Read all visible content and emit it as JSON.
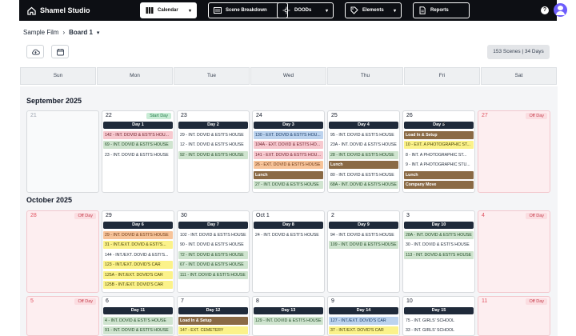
{
  "app": {
    "title": "Shamel Studio"
  },
  "nav": {
    "calendar": "Calendar",
    "scene_breakdown": "Scene Breakdown",
    "doods": "DOODs",
    "elements": "Elements",
    "reports": "Reports"
  },
  "breadcrumb": {
    "project": "Sample Film",
    "board": "Board 1"
  },
  "scene_count": "153 Scenes | 34 Days",
  "weekdays": [
    "Sun",
    "Mon",
    "Tue",
    "Wed",
    "Thu",
    "Fri",
    "Sat"
  ],
  "months": {
    "sep": "September 2025",
    "oct": "October 2025"
  },
  "weeks": [
    {
      "days": [
        {
          "num": "21",
          "type": "empty",
          "badge": "",
          "header": "",
          "items": []
        },
        {
          "num": "22",
          "type": "shoot",
          "badge": "Start Day",
          "header": "Day 1",
          "items": [
            {
              "t": "142 - INT. DOVID & ESTI'S HOU...",
              "c": "pink"
            },
            {
              "t": "69 - INT. DOVID & ESTI'S HOUSE",
              "c": "green"
            },
            {
              "t": "23 - INT. DOVID & ESTI'S HOUSE",
              "c": "white"
            }
          ]
        },
        {
          "num": "23",
          "type": "shoot",
          "badge": "",
          "header": "Day 2",
          "items": [
            {
              "t": "29 - INT. DOVID & ESTI'S HOUSE",
              "c": "white"
            },
            {
              "t": "12 - INT. DOVID & ESTI'S HOUSE",
              "c": "white"
            },
            {
              "t": "92 - INT. DOVID & ESTI'S HOUSE",
              "c": "green"
            }
          ]
        },
        {
          "num": "24",
          "type": "shoot",
          "badge": "",
          "header": "Day 3",
          "items": [
            {
              "t": "130 - EXT. DOVID & ESTI'S HOU...",
              "c": "blue"
            },
            {
              "t": "104A - EXT. DOVID & ESTI'S HO...",
              "c": "pink"
            },
            {
              "t": "141 - EXT. DOVID & ESTI'S HOUSE",
              "c": "pink"
            },
            {
              "t": "26 - EXT. DOVID & ESTI'S HOUSE",
              "c": "orange"
            },
            {
              "t": "Lunch",
              "c": "brown"
            },
            {
              "t": "27 - INT. DOVID & ESTI'S HOUSE",
              "c": "green"
            }
          ]
        },
        {
          "num": "25",
          "type": "shoot",
          "badge": "",
          "header": "Day 4",
          "items": [
            {
              "t": "95 - INT. DOVID & ESTI'S HOUSE",
              "c": "white"
            },
            {
              "t": "23A - INT. DOVID & ESTI'S HOUSE",
              "c": "white"
            },
            {
              "t": "28 - INT. DOVID & ESTI'S HOUSE",
              "c": "green"
            },
            {
              "t": "Lunch",
              "c": "brown"
            },
            {
              "t": "80 - INT. DOVID & ESTI'S HOUSE",
              "c": "white"
            },
            {
              "t": "68A - INT. DOVID & ESTI'S HOUSE",
              "c": "green"
            }
          ]
        },
        {
          "num": "26",
          "type": "shoot",
          "badge": "",
          "header": "Day 5",
          "items": [
            {
              "t": "Load In & Setup",
              "c": "brown"
            },
            {
              "t": "10 - EXT. A PHOTOGRAPHIC ST...",
              "c": "yellow"
            },
            {
              "t": "8 - INT. A PHOTOGRAPHIC ST...",
              "c": "white"
            },
            {
              "t": "9 - INT. A PHOTOGRAPHIC STU...",
              "c": "white"
            },
            {
              "t": "Lunch",
              "c": "brown"
            },
            {
              "t": "Company Move",
              "c": "brown"
            }
          ]
        },
        {
          "num": "27",
          "type": "off",
          "badge": "Off Day",
          "header": "",
          "items": []
        }
      ]
    },
    {
      "days": [
        {
          "num": "28",
          "type": "off",
          "badge": "Off Day",
          "header": "",
          "items": []
        },
        {
          "num": "29",
          "type": "shoot",
          "badge": "",
          "header": "Day 6",
          "items": [
            {
              "t": "29 - INT. DOVID & ESTI'S HOUSE",
              "c": "orange"
            },
            {
              "t": "31 - INT./EXT. DOVID & ESTI'S...",
              "c": "yellow"
            },
            {
              "t": "144 - INT./EXT. DOVID & ESTI'S...",
              "c": "white"
            },
            {
              "t": "123 - INT./EXT. DOVID'S CAR",
              "c": "yellow"
            },
            {
              "t": "125A - INT./EXT. DOVID'S CAR",
              "c": "yellow"
            },
            {
              "t": "125B - INT./EXT. DOVID'S CAR",
              "c": "yellow"
            }
          ]
        },
        {
          "num": "30",
          "type": "shoot",
          "badge": "",
          "header": "Day 7",
          "items": [
            {
              "t": "102 - INT. DOVID & ESTI'S HOUSE",
              "c": "white"
            },
            {
              "t": "90 - INT. DOVID & ESTI'S HOUSE",
              "c": "white"
            },
            {
              "t": "72 - INT. DOVID & ESTI'S HOUSE",
              "c": "green"
            },
            {
              "t": "67 - INT. DOVID & ESTI'S HOUSE",
              "c": "green"
            },
            {
              "t": "111 - INT. DOVID & ESTI'S HOUSE",
              "c": "green"
            }
          ]
        },
        {
          "num": "Oct 1",
          "type": "shoot",
          "badge": "",
          "header": "Day 8",
          "items": [
            {
              "t": "24 - INT. DOVID & ESTI'S HOUSE",
              "c": "white"
            }
          ]
        },
        {
          "num": "2",
          "type": "shoot",
          "badge": "",
          "header": "Day 9",
          "items": [
            {
              "t": "94 - INT. DOVID & ESTI'S HOUSE",
              "c": "white"
            },
            {
              "t": "109 - INT. DOVID & ESTI'S HOUSE",
              "c": "green"
            }
          ]
        },
        {
          "num": "3",
          "type": "shoot",
          "badge": "",
          "header": "Day 10",
          "items": [
            {
              "t": "28A - INT. DOVID & ESTI'S HOUSE",
              "c": "green"
            },
            {
              "t": "30 - INT. DOVID & ESTI'S HOUSE",
              "c": "white"
            },
            {
              "t": "113 - INT. DOVID & ESTI'S HOUSE",
              "c": "green"
            }
          ]
        },
        {
          "num": "4",
          "type": "off",
          "badge": "Off Day",
          "header": "",
          "items": []
        }
      ]
    },
    {
      "days": [
        {
          "num": "5",
          "type": "off",
          "badge": "Off Day",
          "header": "",
          "items": []
        },
        {
          "num": "6",
          "type": "shoot",
          "badge": "",
          "header": "Day 11",
          "items": [
            {
              "t": "4 - INT. DOVID & ESTI'S HOUSE",
              "c": "green"
            },
            {
              "t": "91 - INT. DOVID & ESTI'S HOUSE",
              "c": "green"
            }
          ]
        },
        {
          "num": "7",
          "type": "shoot",
          "badge": "",
          "header": "Day 12",
          "items": [
            {
              "t": "Load In & Setup",
              "c": "brown"
            },
            {
              "t": "147 - EXT. CEMETERY",
              "c": "yellow"
            }
          ]
        },
        {
          "num": "8",
          "type": "shoot",
          "badge": "",
          "header": "Day 13",
          "items": [
            {
              "t": "129 - INT. DOVID & ESTI'S HOUSE",
              "c": "green"
            }
          ]
        },
        {
          "num": "9",
          "type": "shoot",
          "badge": "",
          "header": "Day 14",
          "items": [
            {
              "t": "127 - INT./EXT. DOVID'S CAR",
              "c": "blue"
            },
            {
              "t": "37 - INT./EXT. DOVID'S CAR",
              "c": "yellow"
            }
          ]
        },
        {
          "num": "10",
          "type": "shoot",
          "badge": "",
          "header": "Day 15",
          "items": [
            {
              "t": "75 - INT. GIRLS' SCHOOL",
              "c": "white"
            },
            {
              "t": "33 - INT. GIRLS' SCHOOL",
              "c": "white"
            }
          ]
        },
        {
          "num": "11",
          "type": "off",
          "badge": "Off Day",
          "header": "",
          "items": []
        }
      ]
    }
  ]
}
